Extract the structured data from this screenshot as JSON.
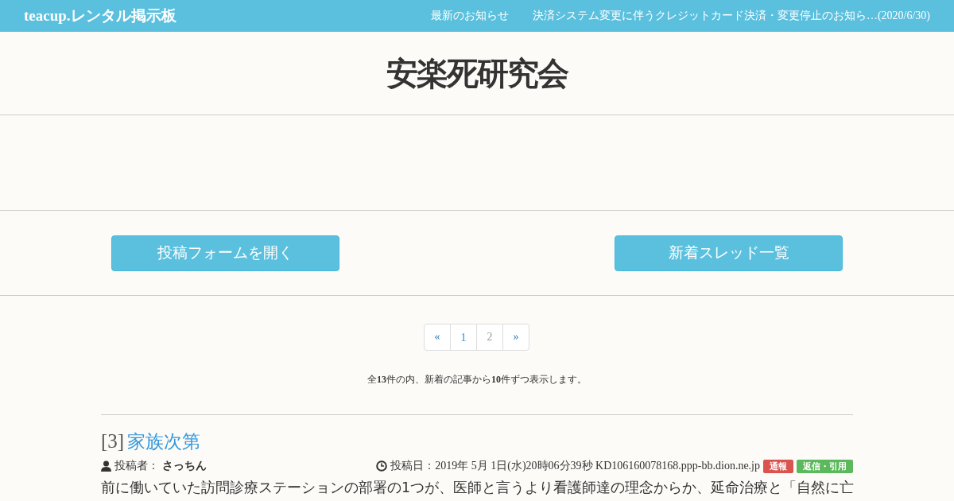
{
  "navbar": {
    "brand": "teacup.レンタル掲示板",
    "links": [
      "最新のお知らせ",
      "決済システム変更に伴うクレジットカード決済・変更停止のお知ら…(2020/6/30)"
    ]
  },
  "board_title": "安楽死研究会",
  "buttons": [
    "投稿フォームを開く",
    "新着スレッド一覧"
  ],
  "pagination": [
    {
      "label": "«",
      "selected": false,
      "disabled": false
    },
    {
      "label": "1",
      "selected": true,
      "disabled": false
    },
    {
      "label": "2",
      "selected": false,
      "disabled": true
    },
    {
      "label": "»",
      "selected": false,
      "disabled": false
    }
  ],
  "count_text": "全**13**件の内、新着の記事から**10**件ずつ表示します。",
  "post": {
    "number": "[3]",
    "title": "家族次第",
    "author_label": "投稿者：",
    "author": "さっちん",
    "date": "投稿日：2019年 5月 1日(水)20時06分39秒 KD106160078168.ppp-bb.dion.ne.jp",
    "badges": [
      {
        "label": "通報",
        "color": "#d9534f"
      },
      {
        "label": "返信・引用",
        "color": "#5cb85c"
      }
    ],
    "body": "前に働いていた訪問診療ステーションの部署の1つが、医師と言うより看護師達の理念からか、延命治療と「自然に亡"
  }
}
